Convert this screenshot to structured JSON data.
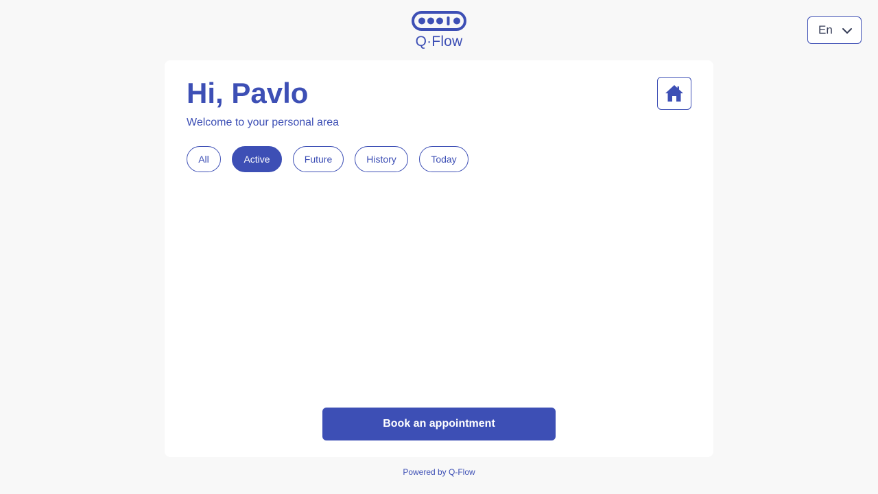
{
  "brand": {
    "name": "Q·Flow",
    "logo_icon": "qflow-queue-logo",
    "accent_color": "#3d4fb5"
  },
  "language": {
    "selected": "En",
    "icon": "chevron-down-icon"
  },
  "header": {
    "greeting": "Hi, Pavlo",
    "subtitle": "Welcome to your personal area",
    "home_icon": "home-icon"
  },
  "tabs": [
    {
      "label": "All",
      "active": false
    },
    {
      "label": "Active",
      "active": true
    },
    {
      "label": "Future",
      "active": false
    },
    {
      "label": "History",
      "active": false
    },
    {
      "label": "Today",
      "active": false
    }
  ],
  "actions": {
    "book_label": "Book an appointment"
  },
  "footer": {
    "text": "Powered by Q-Flow"
  }
}
